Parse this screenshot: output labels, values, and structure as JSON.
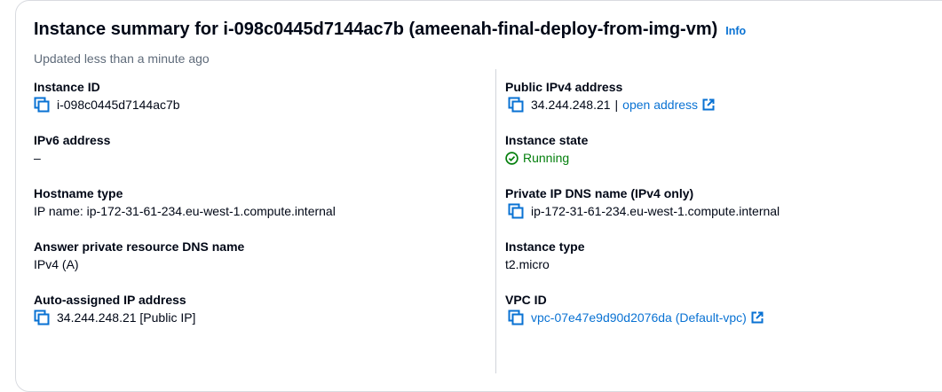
{
  "header": {
    "title": "Instance summary for i-098c0445d7144ac7b (ameenah-final-deploy-from-img-vm)",
    "info_label": "Info",
    "updated": "Updated less than a minute ago"
  },
  "left": {
    "instance_id": {
      "label": "Instance ID",
      "value": "i-098c0445d7144ac7b"
    },
    "ipv6": {
      "label": "IPv6 address",
      "value": "–"
    },
    "hostname_type": {
      "label": "Hostname type",
      "value": "IP name: ip-172-31-61-234.eu-west-1.compute.internal"
    },
    "answer_dns": {
      "label": "Answer private resource DNS name",
      "value": "IPv4 (A)"
    },
    "auto_ip": {
      "label": "Auto-assigned IP address",
      "value": "34.244.248.21 [Public IP]"
    }
  },
  "right": {
    "public_ipv4": {
      "label": "Public IPv4 address",
      "value": "34.244.248.21",
      "separator": "|",
      "link": "open address"
    },
    "instance_state": {
      "label": "Instance state",
      "value": "Running"
    },
    "private_dns": {
      "label": "Private IP DNS name (IPv4 only)",
      "value": "ip-172-31-61-234.eu-west-1.compute.internal"
    },
    "instance_type": {
      "label": "Instance type",
      "value": "t2.micro"
    },
    "vpc_id": {
      "label": "VPC ID",
      "value": "vpc-07e47e9d90d2076da (Default-vpc)"
    }
  },
  "colors": {
    "link": "#0972d3",
    "success": "#037f0c",
    "text": "#000716",
    "muted": "#5f6b7a"
  }
}
